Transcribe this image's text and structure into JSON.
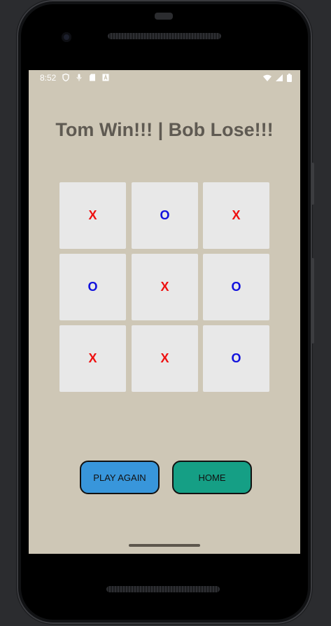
{
  "status_bar": {
    "time": "8:52",
    "left_icons": [
      "shield-icon",
      "mic-icon",
      "sd-card-icon",
      "notification-a-icon"
    ],
    "right_icons": [
      "wifi-icon",
      "signal-icon",
      "battery-icon"
    ]
  },
  "result": {
    "title": "Tom Win!!! | Bob Lose!!!"
  },
  "board": {
    "cells": [
      "X",
      "O",
      "X",
      "O",
      "X",
      "O",
      "X",
      "X",
      "O"
    ]
  },
  "buttons": {
    "play_again": "PLAY AGAIN",
    "home": "HOME"
  },
  "colors": {
    "background": "#cec7b6",
    "x_mark": "#ee1111",
    "o_mark": "#1111dd",
    "cell": "#e8e8e8",
    "play_again_button": "#3896db",
    "home_button": "#159f85",
    "title": "#5f5a52"
  }
}
